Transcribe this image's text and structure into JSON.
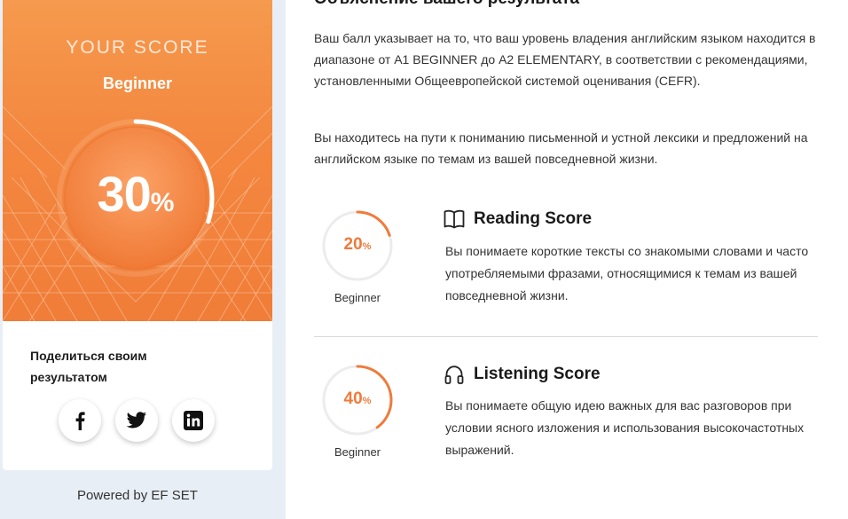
{
  "score_card": {
    "label": "YOUR SCORE",
    "level": "Beginner",
    "value": "30",
    "percent_sign": "%",
    "progress": 0.3,
    "accent_color": "#f4873f"
  },
  "share": {
    "title": "Поделиться своим результатом",
    "buttons": [
      {
        "name": "facebook",
        "icon": "facebook-icon"
      },
      {
        "name": "twitter",
        "icon": "twitter-icon"
      },
      {
        "name": "linkedin",
        "icon": "linkedin-icon"
      }
    ]
  },
  "powered_by": "Powered by EF SET",
  "explanation": {
    "heading": "Объяснение вашего результата",
    "paragraph_1": "Ваш балл указывает на то, что ваш уровень владения английским языком находится в диапазоне от A1 BEGINNER до A2 ELEMENTARY, в соответствии с рекомендациями, установленными Общеевропейской системой оценивания (CEFR).",
    "paragraph_2": "Вы находитесь на пути к пониманию письменной и устной лексики и предложений на английском языке по темам из вашей повседневной жизни."
  },
  "skills": [
    {
      "title": "Reading Score",
      "icon": "book-icon",
      "value": "20",
      "percent_sign": "%",
      "progress": 0.2,
      "level": "Beginner",
      "description": "Вы понимаете короткие тексты со знакомыми словами и часто употребляемыми фразами, относящимися к темам из вашей повседневной жизни."
    },
    {
      "title": "Listening Score",
      "icon": "headphones-icon",
      "value": "40",
      "percent_sign": "%",
      "progress": 0.4,
      "level": "Beginner",
      "description": "Вы понимаете общую идею важных для вас разговоров при условии ясного изложения и использования высокочастотных выражений."
    }
  ]
}
